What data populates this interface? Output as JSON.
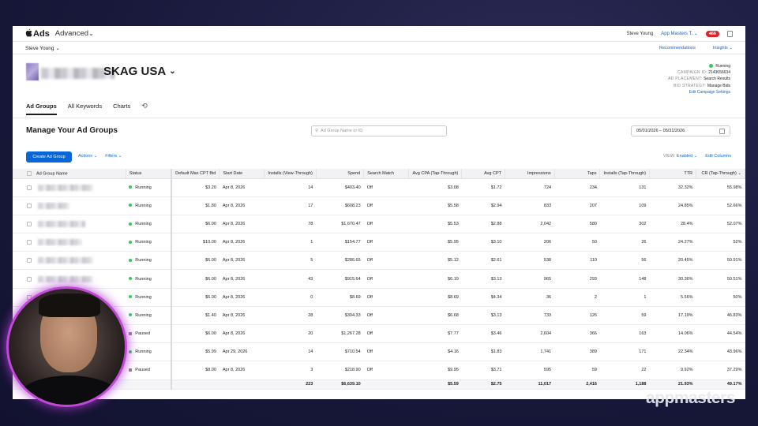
{
  "app": {
    "logo_text": "Ads",
    "product": "Advanced",
    "chevron": "⌄"
  },
  "topbar": {
    "user": "Steve Young",
    "org": "App Masters T.",
    "badge_count": "466"
  },
  "subbar": {
    "account": "Steve Young",
    "recommendations": "Recommendations",
    "insights": "Insights"
  },
  "campaign": {
    "title": "SKAG USA",
    "status": "Running",
    "campaign_id_label": "CAMPAIGN ID:",
    "campaign_id": "2143656634",
    "placement_label": "AD PLACEMENT:",
    "placement": "Search Results",
    "strategy_label": "BID STRATEGY:",
    "strategy": "Manage Bids",
    "edit_link": "Edit Campaign Settings"
  },
  "tabs": [
    "Ad Groups",
    "All Keywords",
    "Charts"
  ],
  "main": {
    "title": "Manage Your Ad Groups",
    "search_placeholder": "Ad Group Name or ID",
    "date_range": "05/01/2026 – 05/31/2026",
    "create_button": "Create Ad Group",
    "actions": "Actions",
    "filters": "Filters",
    "view_label": "VIEW:",
    "view_value": "Enabled",
    "edit_columns": "Edit Columns"
  },
  "table": {
    "headers": [
      "Ad Group Name",
      "Status",
      "Default Max CPT Bid",
      "Start Date",
      "Installs (View-Through)",
      "Spend",
      "Search Match",
      "Avg CPA (Tap-Through)",
      "Avg CPT",
      "Impressions",
      "Taps",
      "Installs (Tap-Through)",
      "TTR",
      "CR (Tap-Through)"
    ],
    "rows": [
      {
        "status": "Running",
        "bid": "$3.20",
        "start": "Apr 8, 2026",
        "vt": "14",
        "spend": "$403.40",
        "sm": "Off",
        "cpa": "$3.08",
        "cpt": "$1.72",
        "imp": "724",
        "taps": "234",
        "inst": "131",
        "ttr": "32.32%",
        "cr": "55.98%"
      },
      {
        "status": "Running",
        "bid": "$1.80",
        "start": "Apr 8, 2026",
        "vt": "17",
        "spend": "$608.23",
        "sm": "Off",
        "cpa": "$5.58",
        "cpt": "$2.94",
        "imp": "833",
        "taps": "207",
        "inst": "109",
        "ttr": "24.85%",
        "cr": "52.66%"
      },
      {
        "status": "Running",
        "bid": "$6.00",
        "start": "Apr 8, 2026",
        "vt": "78",
        "spend": "$1,670.47",
        "sm": "Off",
        "cpa": "$5.53",
        "cpt": "$2.88",
        "imp": "2,042",
        "taps": "580",
        "inst": "302",
        "ttr": "28.4%",
        "cr": "52.07%"
      },
      {
        "status": "Running",
        "bid": "$10.00",
        "start": "Apr 8, 2026",
        "vt": "1",
        "spend": "$154.77",
        "sm": "Off",
        "cpa": "$5.95",
        "cpt": "$3.10",
        "imp": "206",
        "taps": "50",
        "inst": "26",
        "ttr": "24.27%",
        "cr": "52%"
      },
      {
        "status": "Running",
        "bid": "$6.00",
        "start": "Apr 8, 2026",
        "vt": "5",
        "spend": "$286.65",
        "sm": "Off",
        "cpa": "$5.12",
        "cpt": "$2.61",
        "imp": "538",
        "taps": "110",
        "inst": "56",
        "ttr": "20.45%",
        "cr": "50.91%"
      },
      {
        "status": "Running",
        "bid": "$6.00",
        "start": "Apr 8, 2026",
        "vt": "43",
        "spend": "$915.64",
        "sm": "Off",
        "cpa": "$6.19",
        "cpt": "$3.13",
        "imp": "965",
        "taps": "293",
        "inst": "148",
        "ttr": "30.36%",
        "cr": "50.51%"
      },
      {
        "status": "Running",
        "bid": "$6.00",
        "start": "Apr 8, 2026",
        "vt": "0",
        "spend": "$8.69",
        "sm": "Off",
        "cpa": "$8.69",
        "cpt": "$4.34",
        "imp": "36",
        "taps": "2",
        "inst": "1",
        "ttr": "5.56%",
        "cr": "50%"
      },
      {
        "status": "Running",
        "bid": "$1.40",
        "start": "Apr 8, 2026",
        "vt": "28",
        "spend": "$394.33",
        "sm": "Off",
        "cpa": "$6.68",
        "cpt": "$3.13",
        "imp": "733",
        "taps": "126",
        "inst": "59",
        "ttr": "17.19%",
        "cr": "46.83%"
      },
      {
        "status": "Paused",
        "bid": "$6.00",
        "start": "Apr 8, 2026",
        "vt": "20",
        "spend": "$1,267.28",
        "sm": "Off",
        "cpa": "$7.77",
        "cpt": "$3.46",
        "imp": "2,604",
        "taps": "366",
        "inst": "163",
        "ttr": "14.06%",
        "cr": "44.54%"
      },
      {
        "status": "Running",
        "bid": "$5.99",
        "start": "Apr 29, 2026",
        "vt": "14",
        "spend": "$710.54",
        "sm": "Off",
        "cpa": "$4.16",
        "cpt": "$1.83",
        "imp": "1,741",
        "taps": "389",
        "inst": "171",
        "ttr": "22.34%",
        "cr": "43.96%"
      },
      {
        "status": "Paused",
        "bid": "$8.00",
        "start": "Apr 8, 2026",
        "vt": "3",
        "spend": "$218.90",
        "sm": "Off",
        "cpa": "$9.95",
        "cpt": "$3.71",
        "imp": "595",
        "taps": "59",
        "inst": "22",
        "ttr": "9.92%",
        "cr": "37.29%"
      }
    ],
    "totals": {
      "vt": "223",
      "spend": "$6,639.10",
      "cpa": "$5.59",
      "cpt": "$2.75",
      "imp": "11,017",
      "taps": "2,416",
      "inst": "1,188",
      "ttr": "21.93%",
      "cr": "49.17%"
    }
  },
  "watermark": "appmasters",
  "colors": {
    "accent": "#0a66d8",
    "running": "#34c759",
    "paused": "#888888",
    "badge": "#e0202a"
  }
}
